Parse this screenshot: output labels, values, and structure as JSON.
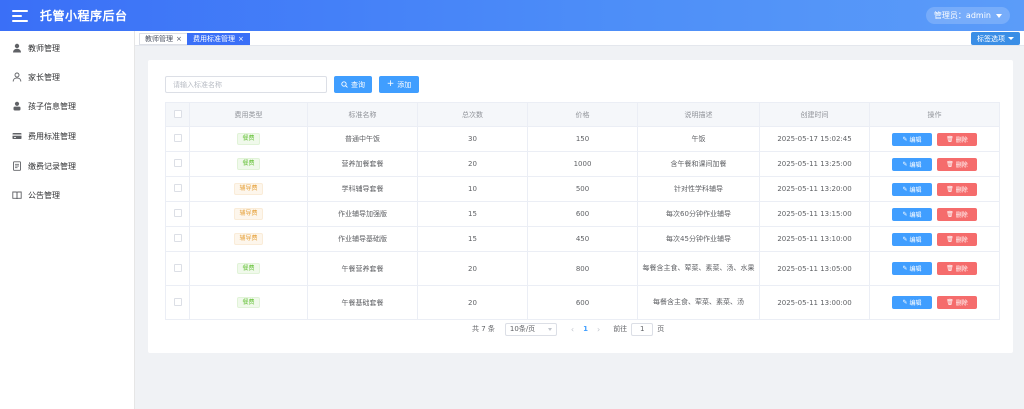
{
  "header": {
    "title": "托管小程序后台",
    "user_menu": "管理员：admin"
  },
  "sidebar": {
    "items": [
      {
        "label": "教师管理",
        "icon": "user-icon"
      },
      {
        "label": "家长管理",
        "icon": "user-outline-icon"
      },
      {
        "label": "孩子信息管理",
        "icon": "child-icon"
      },
      {
        "label": "费用标准管理",
        "icon": "card-icon"
      },
      {
        "label": "缴费记录管理",
        "icon": "document-icon"
      },
      {
        "label": "公告管理",
        "icon": "book-icon"
      }
    ]
  },
  "tabs": {
    "items": [
      {
        "label": "教师管理",
        "close": "×",
        "active": false
      },
      {
        "label": "费用标准管理",
        "close": "×",
        "active": true
      }
    ],
    "options_label": "标签选项"
  },
  "toolbar": {
    "search_placeholder": "请输入标准名称",
    "search_label": "查询",
    "add_label": "添加"
  },
  "table": {
    "headers": [
      "",
      "费用类型",
      "标准名称",
      "总次数",
      "价格",
      "说明描述",
      "创建时间",
      "操作"
    ],
    "edit_label": "编辑",
    "delete_label": "删除",
    "rows": [
      {
        "type": "餐费",
        "name": "普通中午饭",
        "count": "30",
        "price": "150",
        "desc": "午饭",
        "created": "2025-05-17 15:02:45"
      },
      {
        "type": "餐费",
        "name": "营养加餐套餐",
        "count": "20",
        "price": "1000",
        "desc": "含午餐和课间加餐",
        "created": "2025-05-11 13:25:00"
      },
      {
        "type": "辅导费",
        "name": "学科辅导套餐",
        "count": "10",
        "price": "500",
        "desc": "针对性学科辅导",
        "created": "2025-05-11 13:20:00"
      },
      {
        "type": "辅导费",
        "name": "作业辅导加强版",
        "count": "15",
        "price": "600",
        "desc": "每次60分钟作业辅导",
        "created": "2025-05-11 13:15:00"
      },
      {
        "type": "辅导费",
        "name": "作业辅导基础版",
        "count": "15",
        "price": "450",
        "desc": "每次45分钟作业辅导",
        "created": "2025-05-11 13:10:00"
      },
      {
        "type": "餐费",
        "name": "午餐营养套餐",
        "count": "20",
        "price": "800",
        "desc": "每餐含主食、荤菜、素菜、汤、水果",
        "created": "2025-05-11 13:05:00"
      },
      {
        "type": "餐费",
        "name": "午餐基础套餐",
        "count": "20",
        "price": "600",
        "desc": "每餐含主食、荤菜、素菜、汤",
        "created": "2025-05-11 13:00:00"
      }
    ]
  },
  "pagination": {
    "total": "共 7 条",
    "page_size": "10条/页",
    "prev": "‹",
    "current_page": "1",
    "next": "›",
    "goto_label": "前往",
    "goto_value": "1",
    "page_suffix": "页"
  },
  "colors": {
    "header": "#3a6ff7",
    "primary": "#409eff",
    "danger": "#f56c6c",
    "meal_tag": "#67c23a",
    "tutor_tag": "#e6a23c"
  }
}
